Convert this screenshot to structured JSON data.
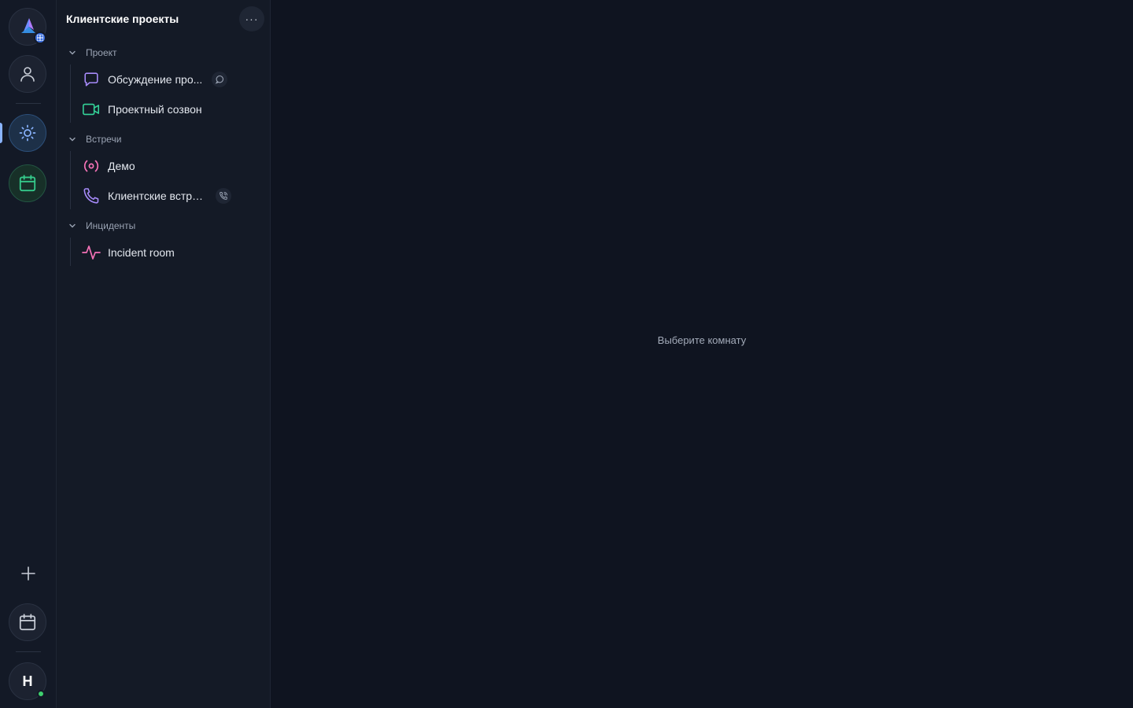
{
  "rail": {
    "workspace_icon": "workspace-logo-icon",
    "profile_icon": "user-icon",
    "active_icon": "sun-icon",
    "calendar_icon": "calendar-icon",
    "add_icon": "plus-icon",
    "bottom_calendar_icon": "calendar-icon",
    "avatar_letter": "Н",
    "presence": "online",
    "colors": {
      "accent": "#8ab4ff",
      "online": "#3ecf6e",
      "calendar_green": "#35c98a"
    }
  },
  "sidebar": {
    "title": "Клиентские проекты",
    "more_label": "···",
    "sections": [
      {
        "label": "Проект",
        "rooms": [
          {
            "label": "Обсуждение про...",
            "icon": "chat-bubble-icon",
            "color": "#a78bfa",
            "badge_icon": "chat-badge-icon"
          },
          {
            "label": "Проектный созвон",
            "icon": "video-camera-icon",
            "color": "#34d399"
          }
        ]
      },
      {
        "label": "Встречи",
        "rooms": [
          {
            "label": "Демо",
            "icon": "broadcast-icon",
            "color": "#f472b6"
          },
          {
            "label": "Клиентские встре...",
            "icon": "phone-icon",
            "color": "#a78bfa",
            "badge_icon": "phone-badge-icon"
          }
        ]
      },
      {
        "label": "Инциденты",
        "rooms": [
          {
            "label": "Incident room",
            "icon": "activity-icon",
            "color": "#f472b6"
          }
        ]
      }
    ]
  },
  "main": {
    "empty_state": "Выберите комнату"
  }
}
